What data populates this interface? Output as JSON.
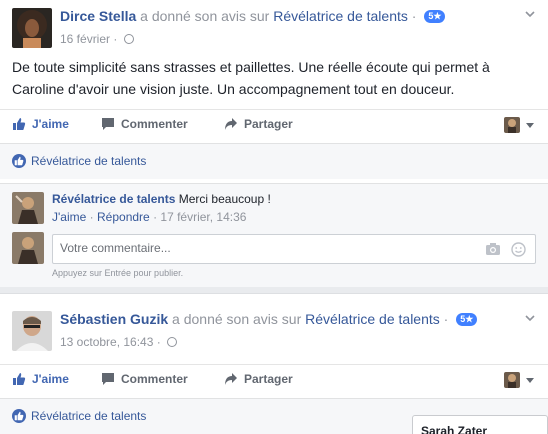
{
  "posts": [
    {
      "author": "Dirce Stella",
      "action": "a donné son avis sur",
      "page": "Révélatrice de talents",
      "rating": "5★",
      "date": "16 février",
      "text": "De toute simplicité sans strasses et paillettes. Une réelle écoute qui permet à Caroline d'avoir une vision juste. Un accompagnement tout en douceur.",
      "liked_by": "Révélatrice de talents",
      "reply": {
        "author": "Révélatrice de talents",
        "text": "Merci beaucoup !",
        "like": "J'aime",
        "respond": "Répondre",
        "timestamp": "17 février, 14:36"
      },
      "comment_placeholder": "Votre commentaire...",
      "comment_hint": "Appuyez sur Entrée pour publier."
    },
    {
      "author": "Sébastien Guzik",
      "action": "a donné son avis sur",
      "page": "Révélatrice de talents",
      "rating": "5★",
      "date": "13 octobre, 16:43",
      "liked_by": "Révélatrice de talents"
    }
  ],
  "actions": {
    "like": "J'aime",
    "comment": "Commenter",
    "share": "Partager"
  },
  "separators": {
    "dot": "·"
  },
  "chat": {
    "name": "Sarah Zater"
  },
  "icons": [
    "globe-icon",
    "chevron-down-icon",
    "thumbs-up-icon",
    "comment-icon",
    "share-icon",
    "camera-icon",
    "smiley-icon"
  ],
  "colors": {
    "link": "#365899",
    "like_active": "#4267b2",
    "badge": "#4080ff",
    "muted": "#90949c",
    "background": "#e9ebee"
  }
}
